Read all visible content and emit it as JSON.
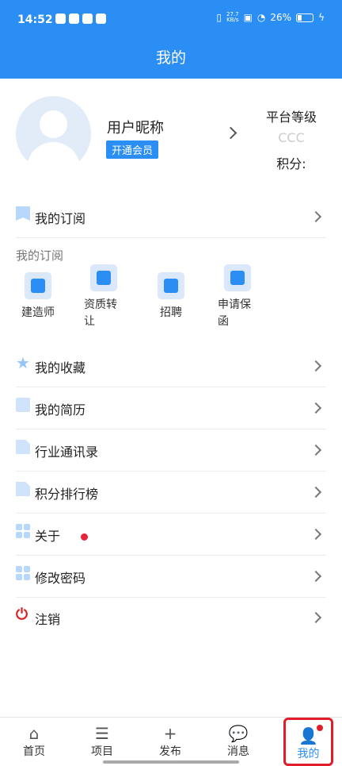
{
  "status_bar": {
    "time": "14:52",
    "net_speed_top": "27.7",
    "net_speed_bottom": "KB/s",
    "battery": "26%"
  },
  "header": {
    "title": "我的"
  },
  "profile": {
    "nickname": "用户昵称",
    "vip_button": "开通会员",
    "level_title": "平台等级",
    "level_value": "CCC",
    "points_label": "积分:"
  },
  "menu_top": {
    "label": "我的订阅"
  },
  "subscriptions": {
    "title": "我的订阅",
    "items": [
      {
        "label": "建造师"
      },
      {
        "label": "资质转让"
      },
      {
        "label": "招聘"
      },
      {
        "label": "申请保函"
      }
    ]
  },
  "menu": [
    {
      "label": "我的收藏"
    },
    {
      "label": "我的简历"
    },
    {
      "label": "行业通讯录"
    },
    {
      "label": "积分排行榜"
    },
    {
      "label": "关于"
    },
    {
      "label": "修改密码"
    },
    {
      "label": "注销"
    }
  ],
  "tabs": [
    {
      "label": "首页",
      "icon": "home-icon"
    },
    {
      "label": "项目",
      "icon": "project-icon"
    },
    {
      "label": "发布",
      "icon": "plus-icon"
    },
    {
      "label": "消息",
      "icon": "message-icon"
    },
    {
      "label": "我的",
      "icon": "person-icon"
    }
  ],
  "colors": {
    "primary": "#2b8ef4",
    "badge_red": "#e8233c",
    "power_red": "#d9231f"
  }
}
